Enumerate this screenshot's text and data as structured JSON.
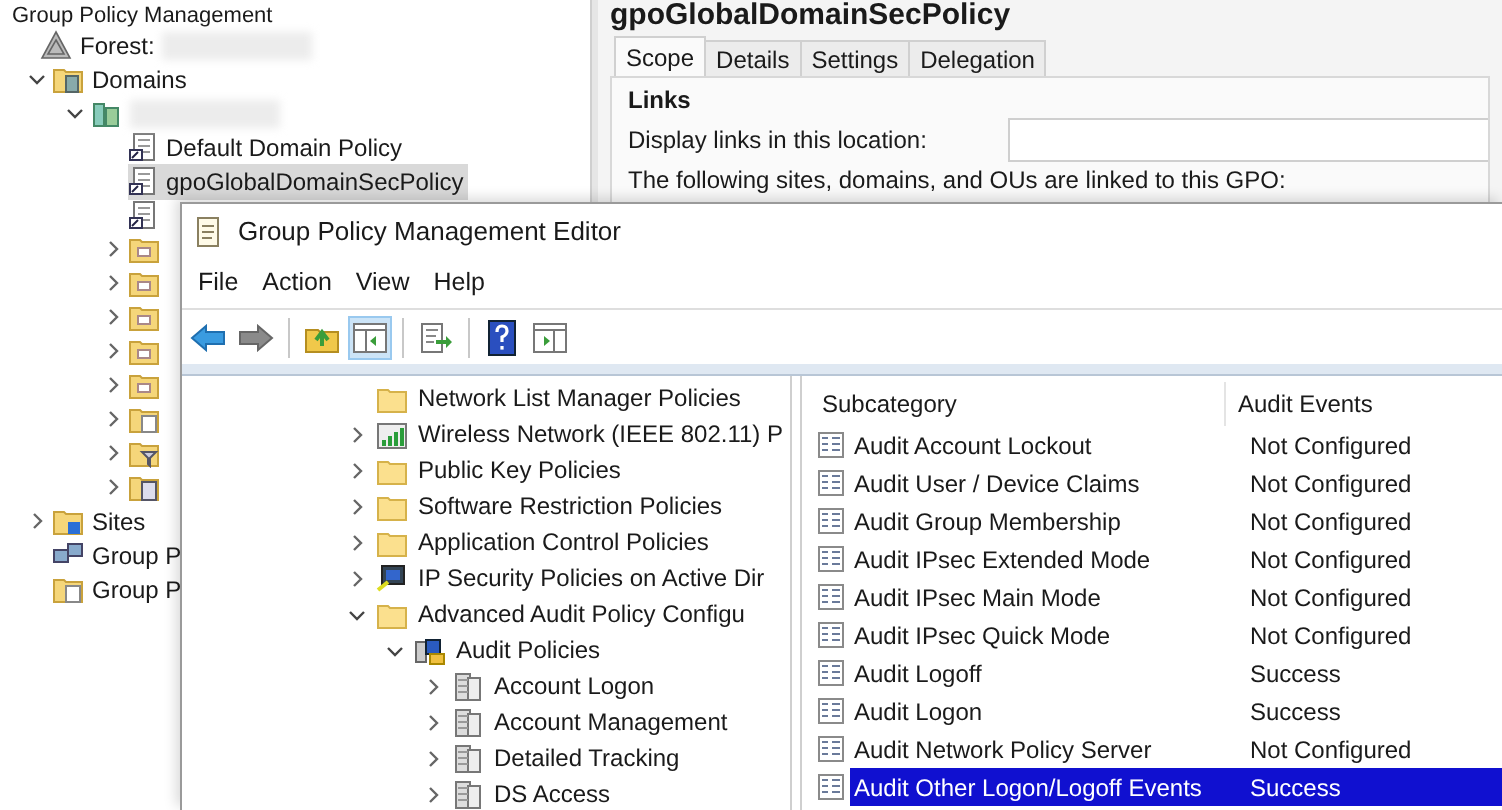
{
  "gpmc": {
    "title": "Group Policy Management",
    "tree": [
      {
        "label": "Forest:",
        "kind": "forest",
        "redacted": true,
        "selected": false,
        "children": [
          {
            "label": "Domains",
            "kind": "domains",
            "expanded": true,
            "selected": false,
            "children": [
              {
                "kind": "domain",
                "redacted": true,
                "expanded": true,
                "selected": false,
                "children": [
                  {
                    "label": "Default Domain Policy",
                    "kind": "gpo-link",
                    "selected": false
                  },
                  {
                    "label": "gpoGlobalDomainSecPolicy",
                    "kind": "gpo-link",
                    "selected": true
                  },
                  {
                    "kind": "gpo-link",
                    "selected": false
                  },
                  {
                    "kind": "ou",
                    "expanded": false,
                    "selected": false
                  },
                  {
                    "kind": "ou",
                    "expanded": false,
                    "selected": false
                  },
                  {
                    "kind": "ou",
                    "expanded": false,
                    "selected": false
                  },
                  {
                    "kind": "ou",
                    "expanded": false,
                    "selected": false
                  },
                  {
                    "kind": "ou",
                    "expanded": false,
                    "selected": false
                  },
                  {
                    "kind": "doc-folder",
                    "expanded": false,
                    "selected": false
                  },
                  {
                    "kind": "filter-folder",
                    "expanded": false,
                    "selected": false
                  },
                  {
                    "kind": "list-folder",
                    "expanded": false,
                    "selected": false
                  }
                ]
              }
            ]
          },
          {
            "label": "Sites",
            "kind": "sites",
            "expanded": false,
            "selected": false
          },
          {
            "label": "Group P",
            "kind": "computers",
            "selected": false
          },
          {
            "label": "Group P",
            "kind": "doc-folder",
            "selected": false
          }
        ]
      }
    ],
    "details": {
      "title": "gpoGlobalDomainSecPolicy",
      "tabs": [
        {
          "label": "Scope",
          "selected": true
        },
        {
          "label": "Details",
          "selected": false
        },
        {
          "label": "Settings",
          "selected": false
        },
        {
          "label": "Delegation",
          "selected": false
        }
      ],
      "section": "Links",
      "location_label": "Display links in this location:",
      "linked_text": "The following sites, domains, and OUs are linked to this GPO:"
    }
  },
  "editor": {
    "title": "Group Policy Management Editor",
    "menu": [
      "File",
      "Action",
      "View",
      "Help"
    ],
    "toolbar": [
      {
        "kind": "back",
        "pressed": false
      },
      {
        "kind": "forward",
        "pressed": false
      },
      {
        "kind": "separator"
      },
      {
        "kind": "up",
        "pressed": false
      },
      {
        "kind": "tree",
        "pressed": true
      },
      {
        "kind": "separator"
      },
      {
        "kind": "export",
        "pressed": false
      },
      {
        "kind": "separator"
      },
      {
        "kind": "help",
        "pressed": false
      },
      {
        "kind": "action-pane",
        "pressed": false
      }
    ],
    "tree": [
      {
        "label": "Network List Manager Policies",
        "kind": "folder"
      },
      {
        "label": "Wireless Network (IEEE 802.11) P",
        "kind": "chart",
        "expanded": false
      },
      {
        "label": "Public Key Policies",
        "kind": "folder",
        "expanded": false
      },
      {
        "label": "Software Restriction Policies",
        "kind": "folder",
        "expanded": false
      },
      {
        "label": "Application Control Policies",
        "kind": "folder",
        "expanded": false
      },
      {
        "label": "IP Security Policies on Active Dir",
        "kind": "computer",
        "expanded": false
      },
      {
        "label": "Advanced Audit Policy Configu",
        "kind": "folder",
        "expanded": true,
        "children": [
          {
            "label": "Audit Policies",
            "kind": "audit",
            "expanded": true,
            "children": [
              {
                "label": "Account Logon",
                "kind": "stack",
                "expanded": false
              },
              {
                "label": "Account Management",
                "kind": "stack",
                "expanded": false
              },
              {
                "label": "Detailed Tracking",
                "kind": "stack",
                "expanded": false
              },
              {
                "label": "DS Access",
                "kind": "stack",
                "expanded": false
              }
            ]
          }
        ]
      }
    ],
    "columns": [
      "Subcategory",
      "Audit Events"
    ],
    "rows": [
      {
        "subcategory": "Audit Account Lockout",
        "audit_events": "Not Configured",
        "selected": false
      },
      {
        "subcategory": "Audit User / Device Claims",
        "audit_events": "Not Configured",
        "selected": false
      },
      {
        "subcategory": "Audit Group Membership",
        "audit_events": "Not Configured",
        "selected": false
      },
      {
        "subcategory": "Audit IPsec Extended Mode",
        "audit_events": "Not Configured",
        "selected": false
      },
      {
        "subcategory": "Audit IPsec Main Mode",
        "audit_events": "Not Configured",
        "selected": false
      },
      {
        "subcategory": "Audit IPsec Quick Mode",
        "audit_events": "Not Configured",
        "selected": false
      },
      {
        "subcategory": "Audit Logoff",
        "audit_events": "Success",
        "selected": false
      },
      {
        "subcategory": "Audit Logon",
        "audit_events": "Success",
        "selected": false
      },
      {
        "subcategory": "Audit Network Policy Server",
        "audit_events": "Not Configured",
        "selected": false
      },
      {
        "subcategory": "Audit Other Logon/Logoff Events",
        "audit_events": "Success",
        "selected": true
      }
    ]
  }
}
